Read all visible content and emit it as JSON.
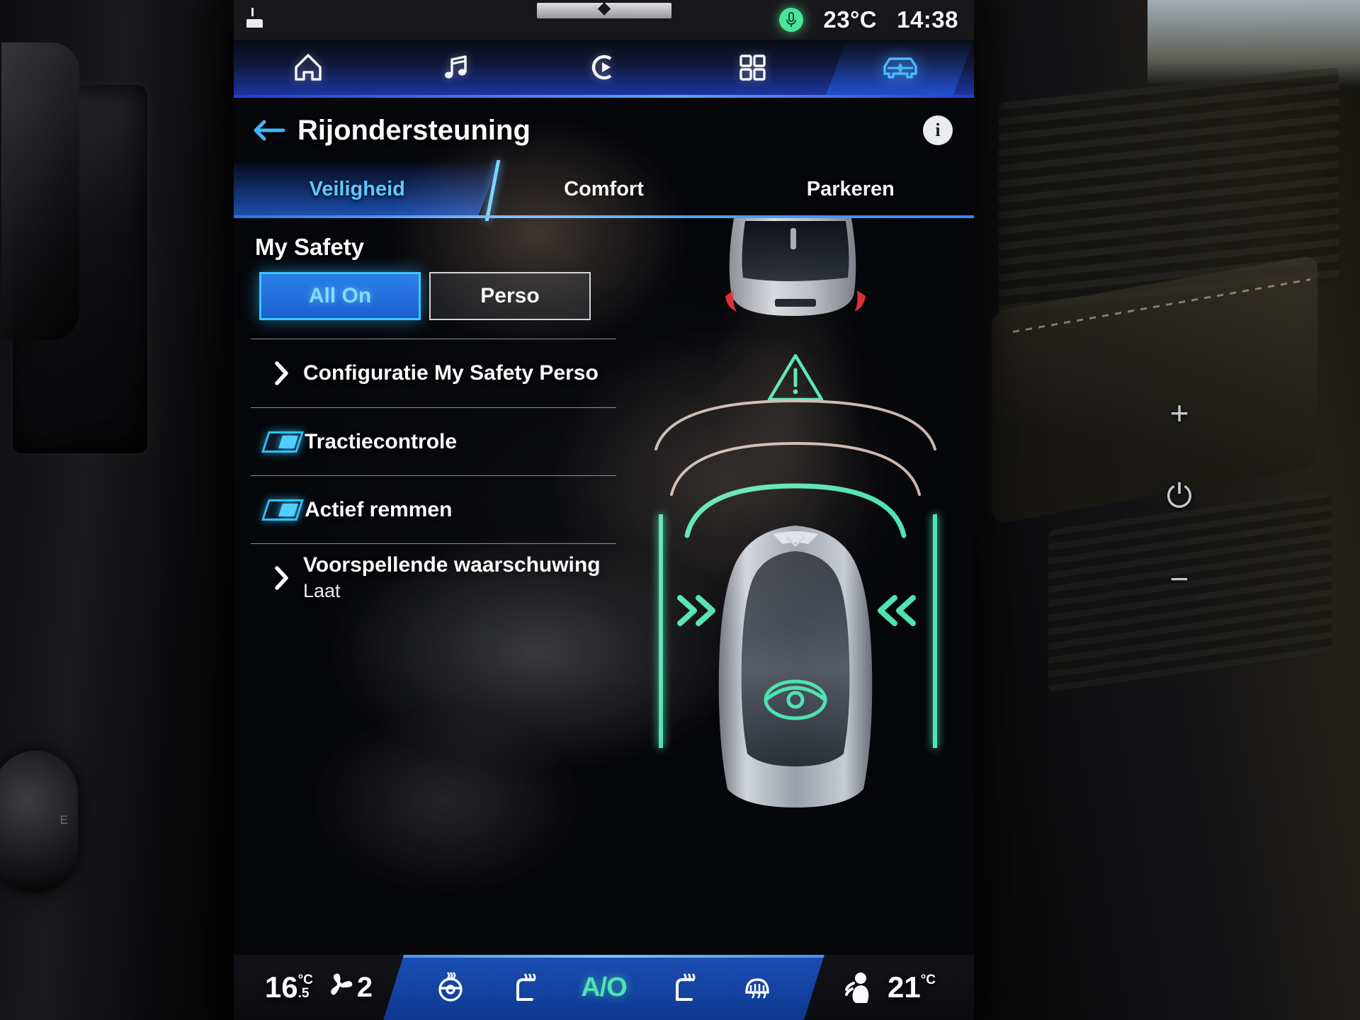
{
  "status_bar": {
    "hood_open_icon": "hood-open-icon",
    "mic_icon": "microphone-icon",
    "temperature": "23°C",
    "time": "14:38",
    "mic_color": "#4de39a"
  },
  "nav_bar": {
    "items": [
      {
        "icon": "home-icon",
        "name": "nav-home",
        "active": false
      },
      {
        "icon": "music-note-icon",
        "name": "nav-media",
        "active": false
      },
      {
        "icon": "play-circle-icon",
        "name": "nav-radio",
        "active": false
      },
      {
        "icon": "apps-grid-icon",
        "name": "nav-apps",
        "active": false
      },
      {
        "icon": "car-icon",
        "name": "nav-vehicle",
        "active": true
      }
    ],
    "active_color": "#4db8ff"
  },
  "header": {
    "back_icon": "arrow-left-icon",
    "title": "Rijondersteuning",
    "info_icon": "info-icon",
    "info_label": "i"
  },
  "tabs": [
    {
      "label": "Veiligheid",
      "active": true
    },
    {
      "label": "Comfort",
      "active": false
    },
    {
      "label": "Parkeren",
      "active": false
    }
  ],
  "my_safety": {
    "title": "My Safety",
    "modes": [
      {
        "label": "All On",
        "selected": true
      },
      {
        "label": "Perso",
        "selected": false
      }
    ]
  },
  "settings_rows": [
    {
      "name": "row-configuratie-my-safety-perso",
      "control": "chevron",
      "icon": "chevron-right-icon",
      "label": "Configuratie My Safety Perso",
      "sub": ""
    },
    {
      "name": "row-tractiecontrole",
      "control": "toggle",
      "icon": "toggle-on-icon",
      "label": "Tractiecontrole",
      "sub": "",
      "state": "on"
    },
    {
      "name": "row-actief-remmen",
      "control": "toggle",
      "icon": "toggle-on-icon",
      "label": "Actief remmen",
      "sub": "",
      "state": "on"
    },
    {
      "name": "row-voorspellende-waarschuwing",
      "control": "chevron",
      "icon": "chevron-right-icon",
      "label": "Voorspellende waarschuwing",
      "sub": "Laat"
    }
  ],
  "vehicle_visual": {
    "lead_car_icon": "lead-vehicle-icon",
    "warning_icon": "warning-triangle-icon",
    "distance_arcs_icon": "distance-arc-icon",
    "ego_car_icon": "ego-vehicle-icon",
    "lane_marker_icon": "lane-marker-icon",
    "left_chevrons_icon": "chevrons-right-icon",
    "right_chevrons_icon": "chevrons-left-icon",
    "accent_green": "#4fe3b0",
    "inactive_arc_color": "#c9b7b0"
  },
  "climate_bar": {
    "left_temperature": "16",
    "left_temperature_unit": "°C",
    "left_temperature_decimal": ".5",
    "fan_icon": "fan-icon",
    "fan_speed": "2",
    "buttons": [
      {
        "name": "steering-wheel-heat-icon",
        "icon": "steering-wheel-heat-icon",
        "active": false
      },
      {
        "name": "seat-heat-left-icon",
        "icon": "seat-heat-icon",
        "active": false
      },
      {
        "name": "auto-mode-button",
        "icon": "a-over-o-icon",
        "label": "A/O",
        "active": true
      },
      {
        "name": "seat-heat-right-icon",
        "icon": "seat-heat-icon",
        "active": false
      },
      {
        "name": "rear-defrost-icon",
        "icon": "rear-defrost-icon",
        "active": false
      }
    ],
    "airflow_icon": "airflow-person-icon",
    "right_temperature": "21",
    "right_temperature_unit": "°C"
  },
  "hard_keys": [
    {
      "name": "volume-up-key",
      "glyph": "+"
    },
    {
      "name": "power-key",
      "glyph": "⏻"
    },
    {
      "name": "volume-down-key",
      "glyph": "−"
    }
  ],
  "knob_label": "E"
}
